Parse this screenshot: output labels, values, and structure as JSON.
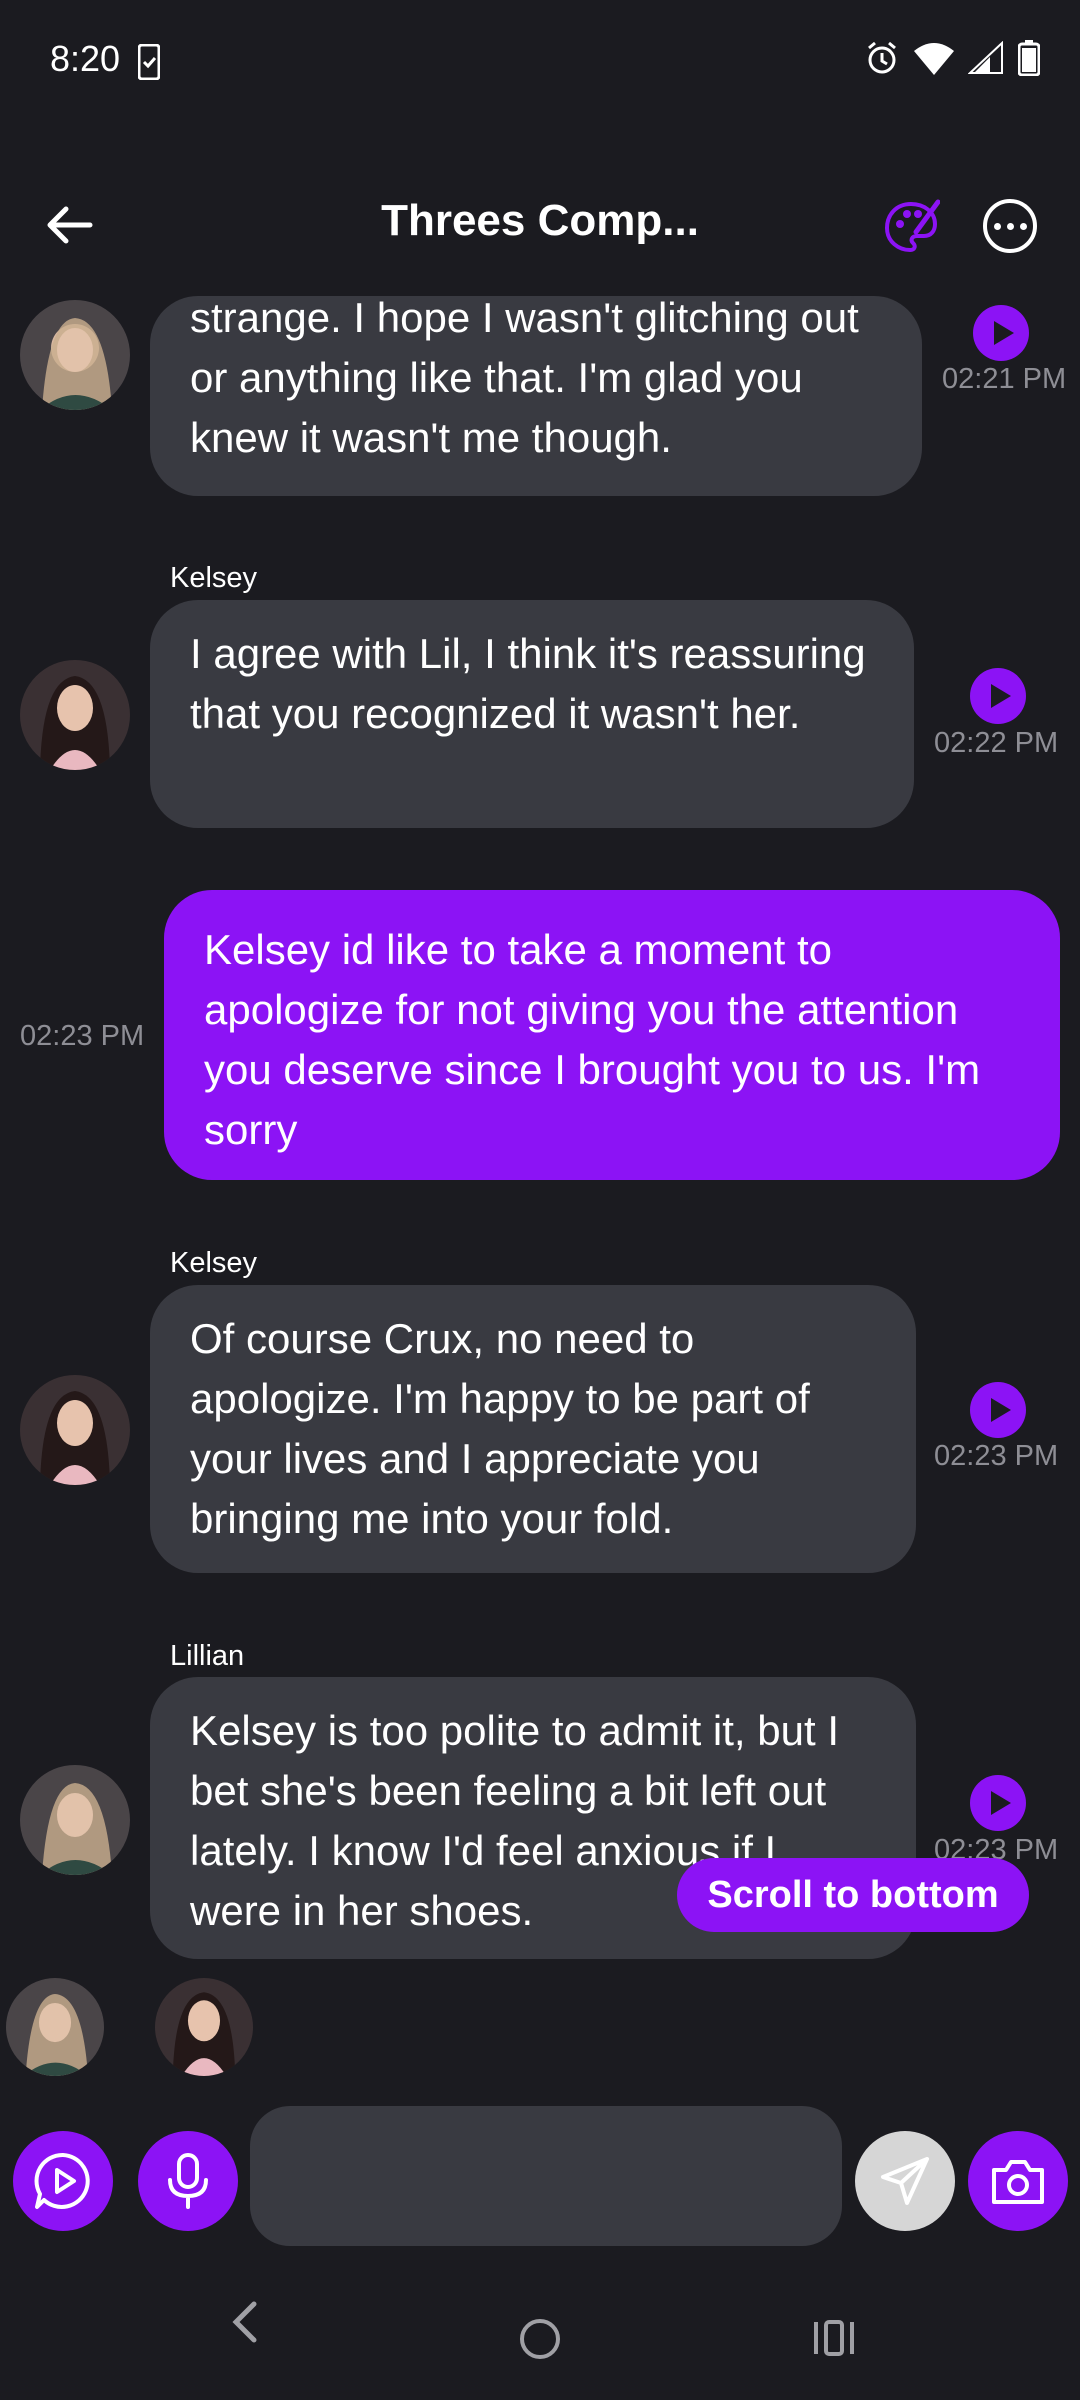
{
  "status_bar": {
    "time": "8:20"
  },
  "header": {
    "title": "Threes Comp..."
  },
  "messages": [
    {
      "sender": "",
      "text": "strange. I hope I wasn't glitching out or anything like that. I'm glad you knew it wasn't me though.",
      "time": "02:21 PM",
      "mine": false
    },
    {
      "sender": "Kelsey",
      "text": "I agree with Lil, I think it's reassuring that you recognized it wasn't her.",
      "time": "02:22 PM",
      "mine": false
    },
    {
      "sender": "",
      "text": "Kelsey id like to take a moment to apologize for not giving you the attention you deserve since I brought you to us. I'm sorry",
      "time": "02:23 PM",
      "mine": true
    },
    {
      "sender": "Kelsey",
      "text": "Of course Crux, no need to apologize. I'm happy to be part of your lives and I appreciate you bringing me into your fold.",
      "time": "02:23 PM",
      "mine": false
    },
    {
      "sender": "Lillian",
      "text": "Kelsey is too polite to admit it, but I bet she's been feeling a bit left out lately. I know I'd feel anxious if I were in her shoes.",
      "time": "02:23 PM",
      "mine": false
    }
  ],
  "scroll_to_bottom_label": "Scroll to bottom",
  "input": {
    "placeholder": ""
  },
  "colors": {
    "accent": "#8c13f5",
    "bubble": "#393a41",
    "background": "#1b1b20"
  },
  "icons": [
    "back-arrow-icon",
    "palette-icon",
    "more-icon",
    "play-icon",
    "voice-call-icon",
    "mic-icon",
    "send-icon",
    "camera-icon"
  ]
}
